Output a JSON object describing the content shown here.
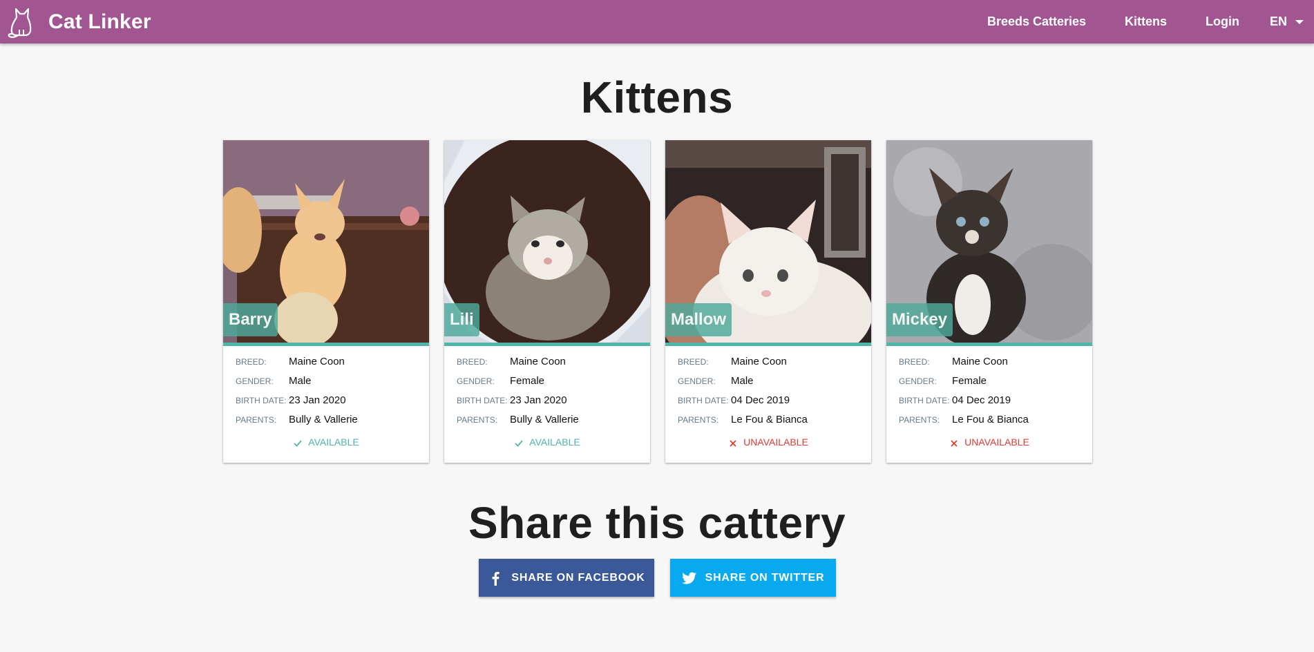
{
  "header": {
    "brand": "Cat Linker",
    "nav": [
      "Breeds",
      "Catteries",
      "Kittens",
      "Login"
    ],
    "language": "EN"
  },
  "colors": {
    "header": "#a15692",
    "accent": "#4fb5a9",
    "available": "#4fb5a9",
    "unavailable": "#e53935",
    "facebook": "#3b5998",
    "twitter": "#08a9ef"
  },
  "main": {
    "title": "Kittens",
    "labels": {
      "breed": "BREED:",
      "gender": "GENDER:",
      "birth_date": "BIRTH DATE:",
      "parents": "PARENTS:"
    },
    "kittens": [
      {
        "name": "Barry",
        "breed": "Maine Coon",
        "gender": "Male",
        "birth_date": "23 Jan 2020",
        "parents": "Bully & Vallerie",
        "status": "AVAILABLE"
      },
      {
        "name": "Lili",
        "breed": "Maine Coon",
        "gender": "Female",
        "birth_date": "23 Jan 2020",
        "parents": "Bully & Vallerie",
        "status": "AVAILABLE"
      },
      {
        "name": "Mallow",
        "breed": "Maine Coon",
        "gender": "Male",
        "birth_date": "04 Dec 2019",
        "parents": "Le Fou & Bianca",
        "status": "UNAVAILABLE"
      },
      {
        "name": "Mickey",
        "breed": "Maine Coon",
        "gender": "Female",
        "birth_date": "04 Dec 2019",
        "parents": "Le Fou & Bianca",
        "status": "UNAVAILABLE"
      }
    ]
  },
  "share": {
    "title": "Share this cattery",
    "facebook_label": "SHARE ON FACEBOOK",
    "twitter_label": "SHARE ON TWITTER"
  },
  "icons": [
    "cat-logo-icon",
    "caret-down-icon",
    "check-icon",
    "close-icon",
    "facebook-icon",
    "twitter-icon"
  ]
}
